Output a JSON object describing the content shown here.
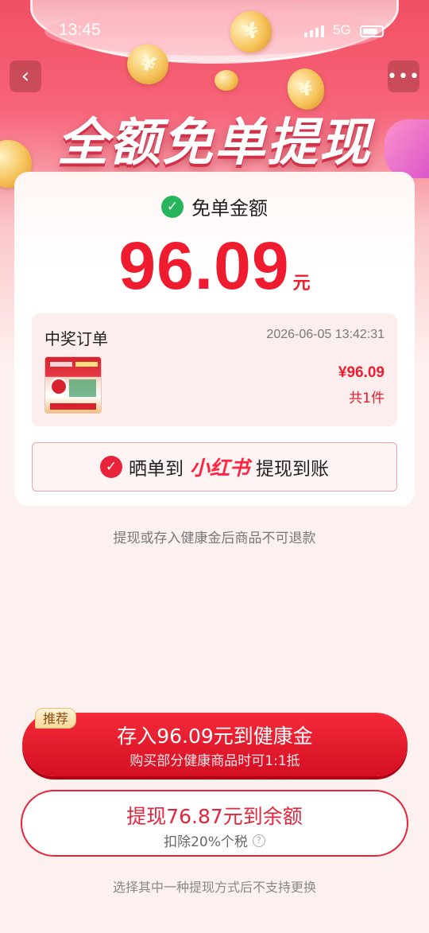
{
  "status_bar": {
    "time": "13:45",
    "network": "5G"
  },
  "nav": {
    "back_icon": "‹",
    "more_icon": "•••"
  },
  "hero": {
    "title": "全额免单提现",
    "coin_symbol": "¥"
  },
  "card": {
    "amount_label": "免单金额",
    "amount_value": "96.09",
    "amount_unit": "元",
    "check_icon": "✓"
  },
  "order": {
    "title": "中奖订单",
    "date": "2026-06-05 13:42:31",
    "price": "¥96.09",
    "count": "共1件"
  },
  "share": {
    "prefix": "晒单到",
    "brand": "小红书",
    "suffix": "提现到账"
  },
  "notices": {
    "refund": "提现或存入健康金后商品不可退款",
    "choose": "选择其中一种提现方式后不支持更换"
  },
  "actions": {
    "recommend_badge": "推荐",
    "primary_main": "存入96.09元到健康金",
    "primary_sub": "购买部分健康商品时可1:1抵",
    "secondary_main": "提现76.87元到余额",
    "secondary_sub": "扣除20%个税",
    "help_icon": "?"
  },
  "colors": {
    "accent_red": "#ee1c2e",
    "success_green": "#27b55b",
    "hero_pink": "#f24f63"
  }
}
